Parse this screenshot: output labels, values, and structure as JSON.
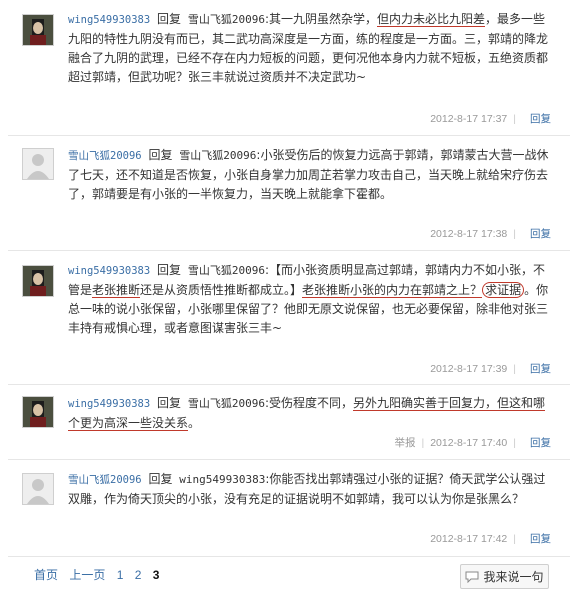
{
  "posts": [
    {
      "author": "wing549930383",
      "reply_word": "回复",
      "target": "雪山飞狐20096",
      "segments": [
        {
          "t": ":其一九阴虽然杂学，",
          "s": ""
        },
        {
          "t": "但内力未必比九阳差",
          "s": "ul"
        },
        {
          "t": "，最多一些九阳的特性九阴没有而已，其二武功高深度是一方面，练的程度是一方面。三，郭靖的降龙融合了九阴的武理，已经不存在内力短板的问题，更何况他本身内力就不短板，五绝资质都超过郭靖，但武功呢？张三丰就说过资质并不决定武功~",
          "s": ""
        }
      ],
      "time": "2012-8-17 17:37",
      "report": "",
      "reply": "回复"
    },
    {
      "author": "雪山飞狐20096",
      "reply_word": "回复",
      "target": "雪山飞狐20096",
      "segments": [
        {
          "t": ":小张受伤后的恢复力远高于郭靖，郭靖蒙古大营一战休了七天，还不知道是否恢复，小张自身掌力加周芷若掌力攻击自己，当天晚上就给宋疗伤去了，郭靖要是有小张的一半恢复力，当天晚上就能拿下霍都。",
          "s": ""
        }
      ],
      "time": "2012-8-17 17:38",
      "report": "",
      "reply": "回复"
    },
    {
      "author": "wing549930383",
      "reply_word": "回复",
      "target": "雪山飞狐20096",
      "segments": [
        {
          "t": ":【而小张资质明显高过郭靖，郭靖内力不如小张，不管是",
          "s": ""
        },
        {
          "t": "老张推断",
          "s": "ul"
        },
        {
          "t": "还是从资质悟性推断都成立。】",
          "s": ""
        },
        {
          "t": "老张推断小张的内力在郭靖之上？",
          "s": "ul"
        },
        {
          "t": "求证据",
          "s": "circ"
        },
        {
          "t": "。你总一味的说小张保留，小张哪里保留了？他即无原文说保留，也无必要保留，除非他对张三丰持有戒惧心理，或者意图谋害张三丰~",
          "s": ""
        }
      ],
      "time": "2012-8-17 17:39",
      "report": "",
      "reply": "回复"
    },
    {
      "author": "wing549930383",
      "reply_word": "回复",
      "target": "雪山飞狐20096",
      "segments": [
        {
          "t": ":受伤程度不同，",
          "s": ""
        },
        {
          "t": "另外九阳确实善于回复力，但这和哪个更为高深一些没关系",
          "s": "ul"
        },
        {
          "t": "。",
          "s": ""
        }
      ],
      "time": "2012-8-17 17:40",
      "report": "举报",
      "reply": "回复"
    },
    {
      "author": "雪山飞狐20096",
      "reply_word": "回复",
      "target": "wing549930383",
      "segments": [
        {
          "t": ":你能否找出郭靖强过小张的证据？倚天武学公认强过双雕，作为倚天顶尖的小张，没有充足的证据说明不如郭靖，我可以认为你是张黑么？",
          "s": ""
        }
      ],
      "time": "2012-8-17 17:42",
      "report": "",
      "reply": "回复"
    }
  ],
  "pager": {
    "first": "首页",
    "prev": "上一页",
    "pages": [
      "1",
      "2",
      "3"
    ],
    "current": "3"
  },
  "say_button": "我来说一句",
  "icons": {
    "avatar_char": "avatar-character-icon",
    "avatar_default": "default-avatar-icon",
    "say": "speech-bubble-icon"
  },
  "colors": {
    "link": "#3a6ea5",
    "annotation": "#c0392b",
    "meta": "#999999"
  }
}
